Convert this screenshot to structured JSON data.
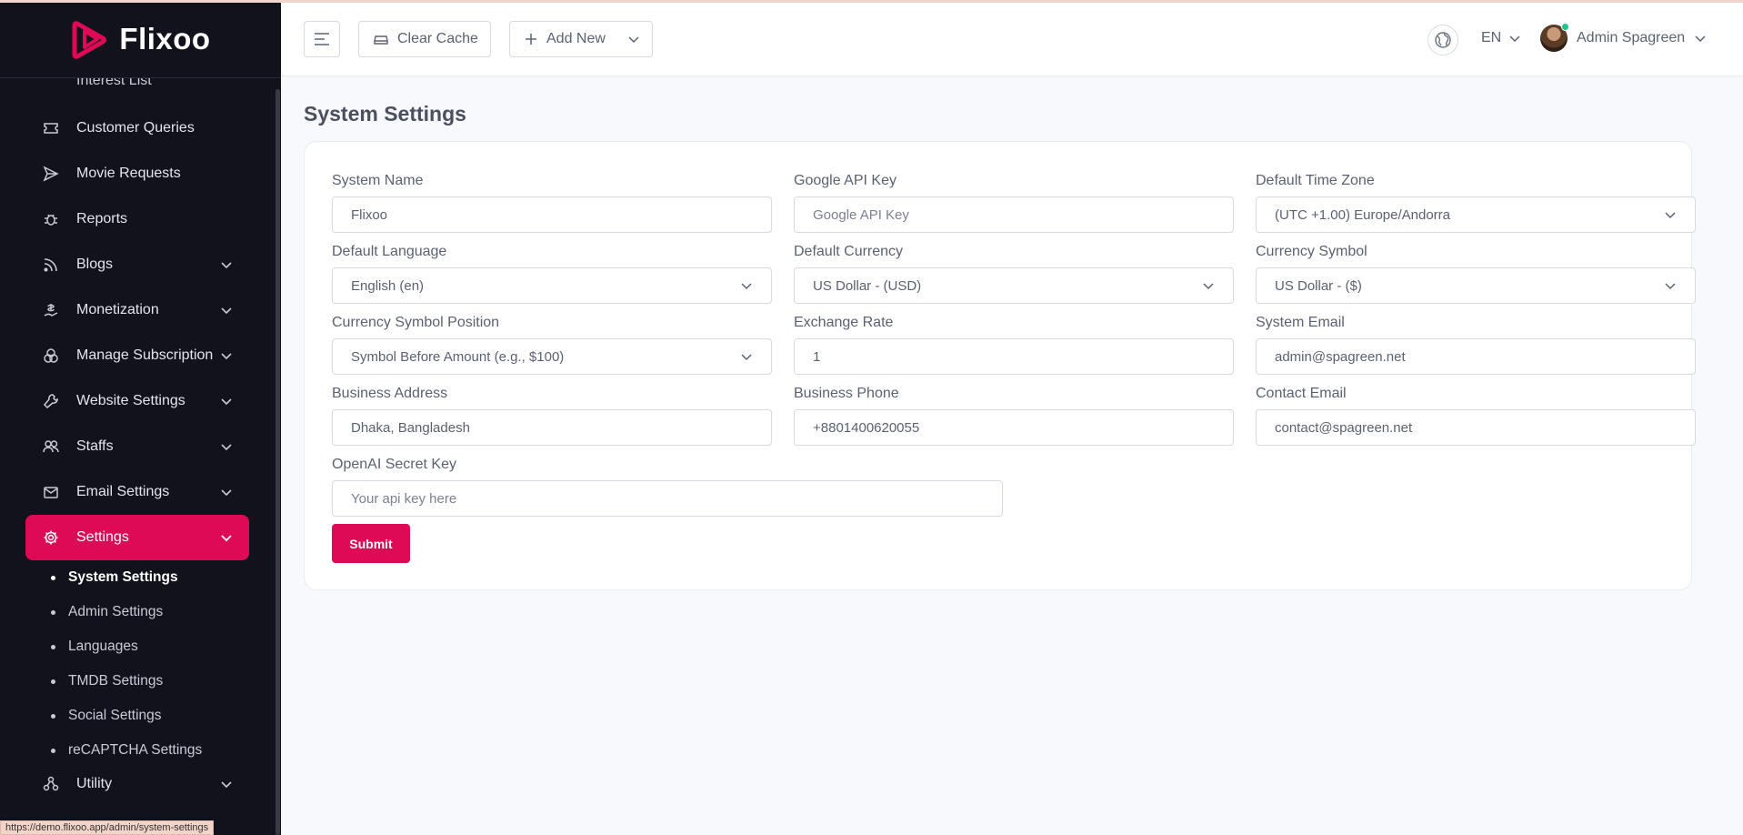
{
  "app": {
    "name": "Flixoo",
    "url": "https://demo.flixoo.app/admin/system-settings"
  },
  "header": {
    "clear_cache_label": "Clear Cache",
    "add_new_label": "Add New",
    "language": "EN",
    "user_name": "Admin Spagreen"
  },
  "sidebar": {
    "partial_item": "Interest List",
    "items": [
      {
        "label": "Customer Queries",
        "icon": "ticket-icon"
      },
      {
        "label": "Movie Requests",
        "icon": "send-icon"
      },
      {
        "label": "Reports",
        "icon": "bug-icon"
      },
      {
        "label": "Blogs",
        "icon": "rss-icon"
      },
      {
        "label": "Monetization",
        "icon": "money-icon"
      },
      {
        "label": "Manage Subscription",
        "icon": "coins-icon"
      },
      {
        "label": "Website Settings",
        "icon": "wrench-icon"
      },
      {
        "label": "Staffs",
        "icon": "users-icon"
      },
      {
        "label": "Email Settings",
        "icon": "mail-icon"
      },
      {
        "label": "Settings",
        "icon": "gear-icon"
      }
    ],
    "settings_submenu": [
      {
        "label": "System Settings"
      },
      {
        "label": "Admin Settings"
      },
      {
        "label": "Languages"
      },
      {
        "label": "TMDB Settings"
      },
      {
        "label": "Social Settings"
      },
      {
        "label": "reCAPTCHA Settings"
      }
    ],
    "utility_label": "Utility"
  },
  "page": {
    "title": "System Settings",
    "submit_label": "Submit"
  },
  "form": {
    "system_name": {
      "label": "System Name",
      "value": "Flixoo"
    },
    "google_api_key": {
      "label": "Google API Key",
      "placeholder": "Google API Key"
    },
    "default_time_zone": {
      "label": "Default Time Zone",
      "value": "(UTC +1.00) Europe/Andorra"
    },
    "default_language": {
      "label": "Default Language",
      "value": "English (en)"
    },
    "default_currency": {
      "label": "Default Currency",
      "value": "US Dollar - (USD)"
    },
    "currency_symbol": {
      "label": "Currency Symbol",
      "value": "US Dollar - ($)"
    },
    "currency_symbol_position": {
      "label": "Currency Symbol Position",
      "value": "Symbol Before Amount (e.g., $100)"
    },
    "exchange_rate": {
      "label": "Exchange Rate",
      "value": "1"
    },
    "system_email": {
      "label": "System Email",
      "value": "admin@spagreen.net"
    },
    "business_address": {
      "label": "Business Address",
      "value": "Dhaka, Bangladesh"
    },
    "business_phone": {
      "label": "Business Phone",
      "value": "+8801400620055"
    },
    "contact_email": {
      "label": "Contact Email",
      "value": "contact@spagreen.net"
    },
    "openai_secret_key": {
      "label": "OpenAI Secret Key",
      "placeholder": "Your api key here"
    }
  },
  "colors": {
    "accent": "#de0a55",
    "sidebar_bg": "#12121d"
  }
}
